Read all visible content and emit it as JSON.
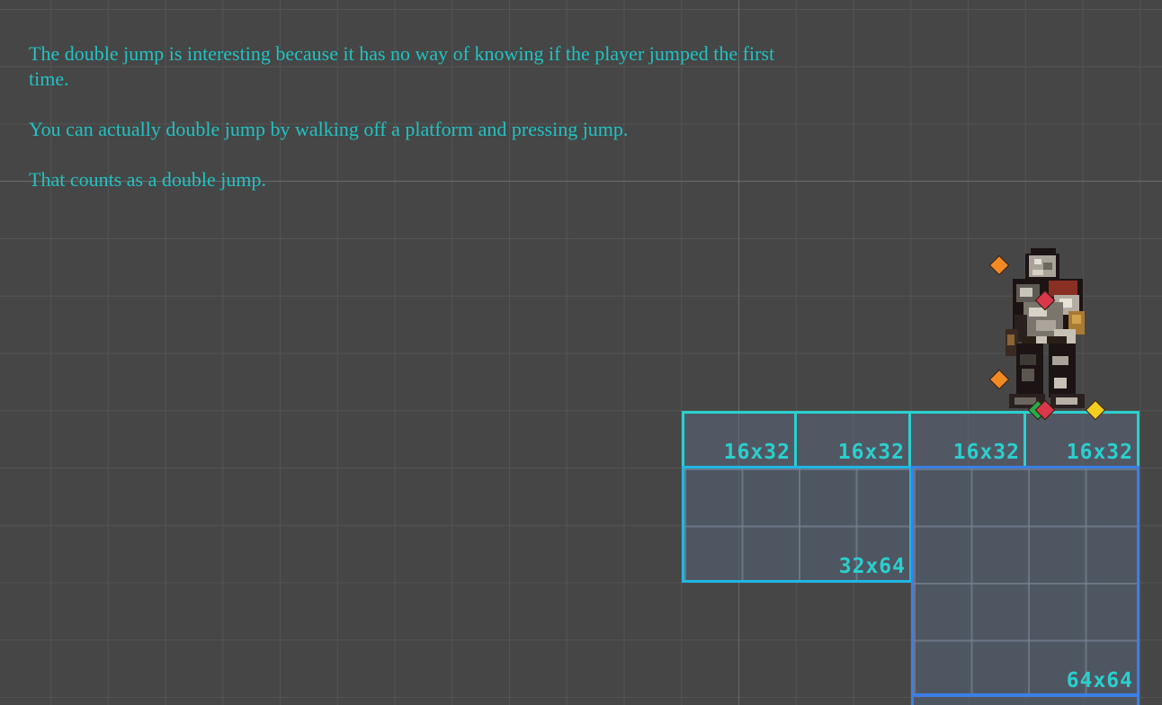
{
  "description_lines": [
    "The double jump is interesting because it has no way of knowing if the player jumped the first",
    "time.",
    "You can actually double jump by walking off a platform and pressing jump.",
    "That counts as a double jump."
  ],
  "tiles": {
    "small": [
      "16x32",
      "16x32",
      "16x32",
      "16x32"
    ],
    "mid": "32x64",
    "large": "64x64"
  },
  "colors": {
    "text": "#22c2c2",
    "small_tile_border": "#2ad0cf",
    "mid_tile_border": "#1fb7e6",
    "large_tile_border": "#3b7fe6",
    "background": "#464646"
  },
  "icons": {
    "character": "armored-knight-sprite",
    "handles": [
      "orange-handle",
      "red-handle",
      "yellow-handle",
      "green-handle"
    ]
  }
}
